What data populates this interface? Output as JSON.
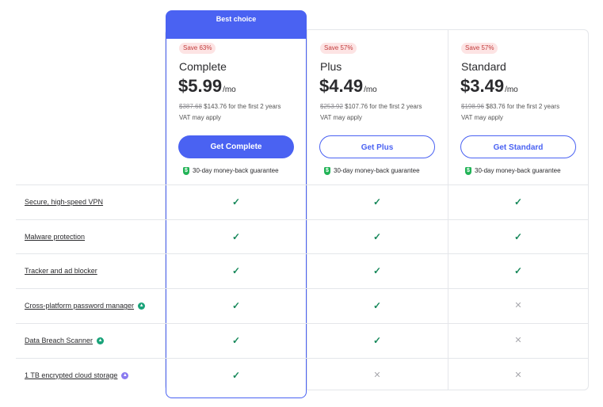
{
  "best_choice_label": "Best choice",
  "plans": [
    {
      "save": "Save 63%",
      "name": "Complete",
      "price": "$5.99",
      "unit": "/mo",
      "original": "$387.68",
      "promo": "$143.76 for the first 2 years",
      "vat": "VAT may apply",
      "cta": "Get Complete",
      "guarantee": "30-day money-back guarantee"
    },
    {
      "save": "Save 57%",
      "name": "Plus",
      "price": "$4.49",
      "unit": "/mo",
      "original": "$253.92",
      "promo": "$107.76 for the first 2 years",
      "vat": "VAT may apply",
      "cta": "Get Plus",
      "guarantee": "30-day money-back guarantee"
    },
    {
      "save": "Save 57%",
      "name": "Standard",
      "price": "$3.49",
      "unit": "/mo",
      "original": "$198.96",
      "promo": "$83.76 for the first 2 years",
      "vat": "VAT may apply",
      "cta": "Get Standard",
      "guarantee": "30-day money-back guarantee"
    }
  ],
  "features": [
    {
      "label": "Secure, high-speed VPN",
      "icon": null,
      "included": [
        true,
        true,
        true
      ]
    },
    {
      "label": "Malware protection",
      "icon": null,
      "included": [
        true,
        true,
        true
      ]
    },
    {
      "label": "Tracker and ad blocker",
      "icon": null,
      "included": [
        true,
        true,
        true
      ]
    },
    {
      "label": "Cross-platform password manager",
      "icon": "password-manager-icon",
      "icon_color": "#1aa37a",
      "included": [
        true,
        true,
        false
      ]
    },
    {
      "label": "Data Breach Scanner",
      "icon": "breach-scanner-icon",
      "icon_color": "#1aa37a",
      "included": [
        true,
        true,
        false
      ]
    },
    {
      "label": "1 TB encrypted cloud storage",
      "icon": "cloud-storage-icon",
      "icon_color": "#8a7bf0",
      "included": [
        true,
        false,
        false
      ]
    }
  ],
  "colors": {
    "accent": "#4a62f2",
    "check": "#17885a",
    "cross": "#a8a8ad",
    "save_bg": "#fde4e4",
    "shield": "#21b356"
  }
}
